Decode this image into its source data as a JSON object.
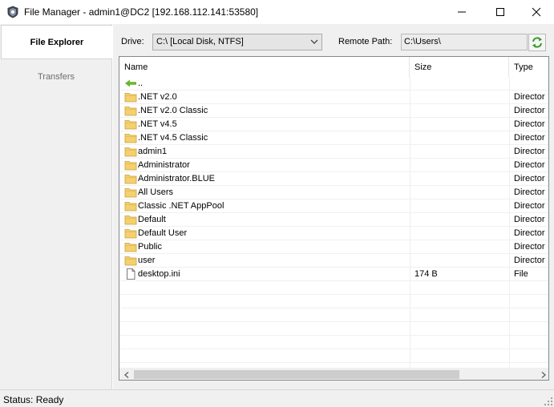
{
  "window": {
    "title": "File Manager - admin1@DC2 [192.168.112.141:53580]",
    "icon": "app-shield-icon",
    "controls": [
      "minimize-icon",
      "maximize-icon",
      "close-icon"
    ]
  },
  "sidebar": {
    "tabs": [
      {
        "label": "File Explorer",
        "active": true
      },
      {
        "label": "Transfers",
        "active": false
      }
    ]
  },
  "toolbar": {
    "drive_label": "Drive:",
    "drive_value": "C:\\ [Local Disk, NTFS]",
    "remote_path_label": "Remote Path:",
    "remote_path_value": "C:\\Users\\",
    "refresh_icon": "refresh-icon",
    "accent": "#3c9a2c"
  },
  "file_list": {
    "columns": [
      "Name",
      "Size",
      "Type"
    ],
    "rows": [
      {
        "name": "..",
        "size": "",
        "type": "",
        "icon": "back-arrow-icon"
      },
      {
        "name": ".NET v2.0",
        "size": "",
        "type": "Director",
        "icon": "folder-icon"
      },
      {
        "name": ".NET v2.0 Classic",
        "size": "",
        "type": "Director",
        "icon": "folder-icon"
      },
      {
        "name": ".NET v4.5",
        "size": "",
        "type": "Director",
        "icon": "folder-icon"
      },
      {
        "name": ".NET v4.5 Classic",
        "size": "",
        "type": "Director",
        "icon": "folder-icon"
      },
      {
        "name": "admin1",
        "size": "",
        "type": "Director",
        "icon": "folder-icon"
      },
      {
        "name": "Administrator",
        "size": "",
        "type": "Director",
        "icon": "folder-icon"
      },
      {
        "name": "Administrator.BLUE",
        "size": "",
        "type": "Director",
        "icon": "folder-icon"
      },
      {
        "name": "All Users",
        "size": "",
        "type": "Director",
        "icon": "folder-icon"
      },
      {
        "name": "Classic .NET AppPool",
        "size": "",
        "type": "Director",
        "icon": "folder-icon"
      },
      {
        "name": "Default",
        "size": "",
        "type": "Director",
        "icon": "folder-icon"
      },
      {
        "name": "Default User",
        "size": "",
        "type": "Director",
        "icon": "folder-icon"
      },
      {
        "name": "Public",
        "size": "",
        "type": "Director",
        "icon": "folder-icon"
      },
      {
        "name": "user",
        "size": "",
        "type": "Director",
        "icon": "folder-icon"
      },
      {
        "name": "desktop.ini",
        "size": "174 B",
        "type": "File",
        "icon": "file-icon"
      }
    ],
    "empty_rows": 7
  },
  "status": {
    "text": "Status: Ready"
  }
}
